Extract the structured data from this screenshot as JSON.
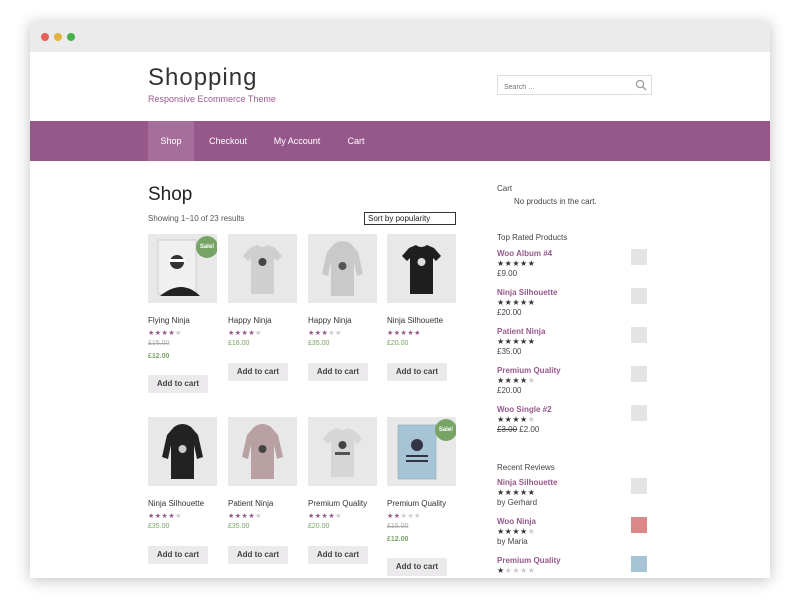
{
  "site": {
    "title": "Shopping",
    "tagline": "Responsive Ecommerce Theme",
    "search_placeholder": "Search …"
  },
  "nav": [
    {
      "label": "Shop"
    },
    {
      "label": "Checkout"
    },
    {
      "label": "My Account"
    },
    {
      "label": "Cart"
    }
  ],
  "shop": {
    "title": "Shop",
    "result_count": "Showing 1–10 of 23 results",
    "orderby": "Sort by popularity",
    "add_to_cart": "Add to cart",
    "sale_badge": "Sale!"
  },
  "products": [
    {
      "name": "Flying Ninja",
      "rating": 4,
      "price_old": "£15.00",
      "price": "£12.00",
      "sale": true
    },
    {
      "name": "Happy Ninja",
      "rating": 4,
      "price": "£18.00",
      "sale": false
    },
    {
      "name": "Happy Ninja",
      "rating": 3,
      "price": "£35.00",
      "sale": false
    },
    {
      "name": "Ninja Silhouette",
      "rating": 5,
      "price": "£20.00",
      "sale": false
    },
    {
      "name": "Ninja Silhouette",
      "rating": 4,
      "price": "£35.00",
      "sale": false
    },
    {
      "name": "Patient Ninja",
      "rating": 4.5,
      "price": "£35.00",
      "sale": false
    },
    {
      "name": "Premium Quality",
      "rating": 4.5,
      "price": "£20.00",
      "sale": false
    },
    {
      "name": "Premium Quality",
      "rating": 2,
      "price_old": "£15.00",
      "price": "£12.00",
      "sale": true
    }
  ],
  "sidebar": {
    "cart_title": "Cart",
    "cart_empty": "No products in the cart.",
    "top_rated_title": "Top Rated Products",
    "top_rated": [
      {
        "name": "Woo Album #4",
        "rating": 5,
        "price": "£9.00"
      },
      {
        "name": "Ninja Silhouette",
        "rating": 5,
        "price": "£20.00"
      },
      {
        "name": "Patient Ninja",
        "rating": 5,
        "price": "£35.00"
      },
      {
        "name": "Premium Quality",
        "rating": 4.5,
        "price": "£20.00"
      },
      {
        "name": "Woo Single #2",
        "rating": 4.5,
        "price_old": "£3.00",
        "price": "£2.00"
      }
    ],
    "reviews_title": "Recent Reviews",
    "reviews": [
      {
        "name": "Ninja Silhouette",
        "rating": 5,
        "by": "by Gerhard"
      },
      {
        "name": "Woo Ninja",
        "rating": 4,
        "by": "by Maria"
      },
      {
        "name": "Premium Quality",
        "rating": 1,
        "by": ""
      }
    ]
  },
  "colors": {
    "accent": "#96588a",
    "nav_active": "#a66f9b",
    "price": "#77a464",
    "button_bg": "#ebe9eb"
  }
}
